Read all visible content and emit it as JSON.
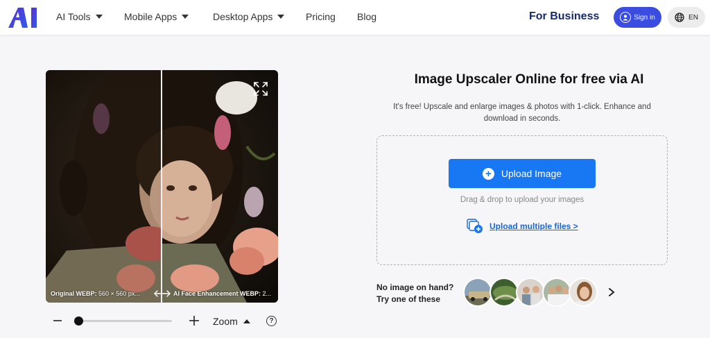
{
  "header": {
    "logo_text": "AI",
    "nav": [
      {
        "label": "AI Tools",
        "dropdown": true
      },
      {
        "label": "Mobile Apps",
        "dropdown": true
      },
      {
        "label": "Desktop Apps",
        "dropdown": true
      },
      {
        "label": "Pricing",
        "dropdown": false
      },
      {
        "label": "Blog",
        "dropdown": false
      }
    ],
    "for_business": "For Business",
    "sign_in": "Sign in",
    "language": "EN"
  },
  "compare": {
    "original_label": "Original WEBP:",
    "original_size": "560 × 560 px...",
    "enhanced_label": "AI Face Enhancement WEBP:",
    "enhanced_size": "2..."
  },
  "zoom": {
    "label": "Zoom",
    "help": "?",
    "level": 0
  },
  "main": {
    "title": "Image Upscaler Online for free via AI",
    "subtitle": "It's free! Upscale and enlarge images & photos with 1-click. Enhance and download in seconds.",
    "upload_button": "Upload Image",
    "drag_text": "Drag & drop to upload your images",
    "multiple_link": "Upload multiple files >"
  },
  "samples_section": {
    "line1": "No image on hand?",
    "line2": "Try one of these",
    "thumbnails": [
      "car",
      "landscape",
      "group",
      "group",
      "portrait"
    ]
  },
  "colors": {
    "accent": "#1877f2",
    "signin_bg": "#3b4ce0",
    "business": "#152a6b",
    "logo": "#3b3fd8"
  }
}
